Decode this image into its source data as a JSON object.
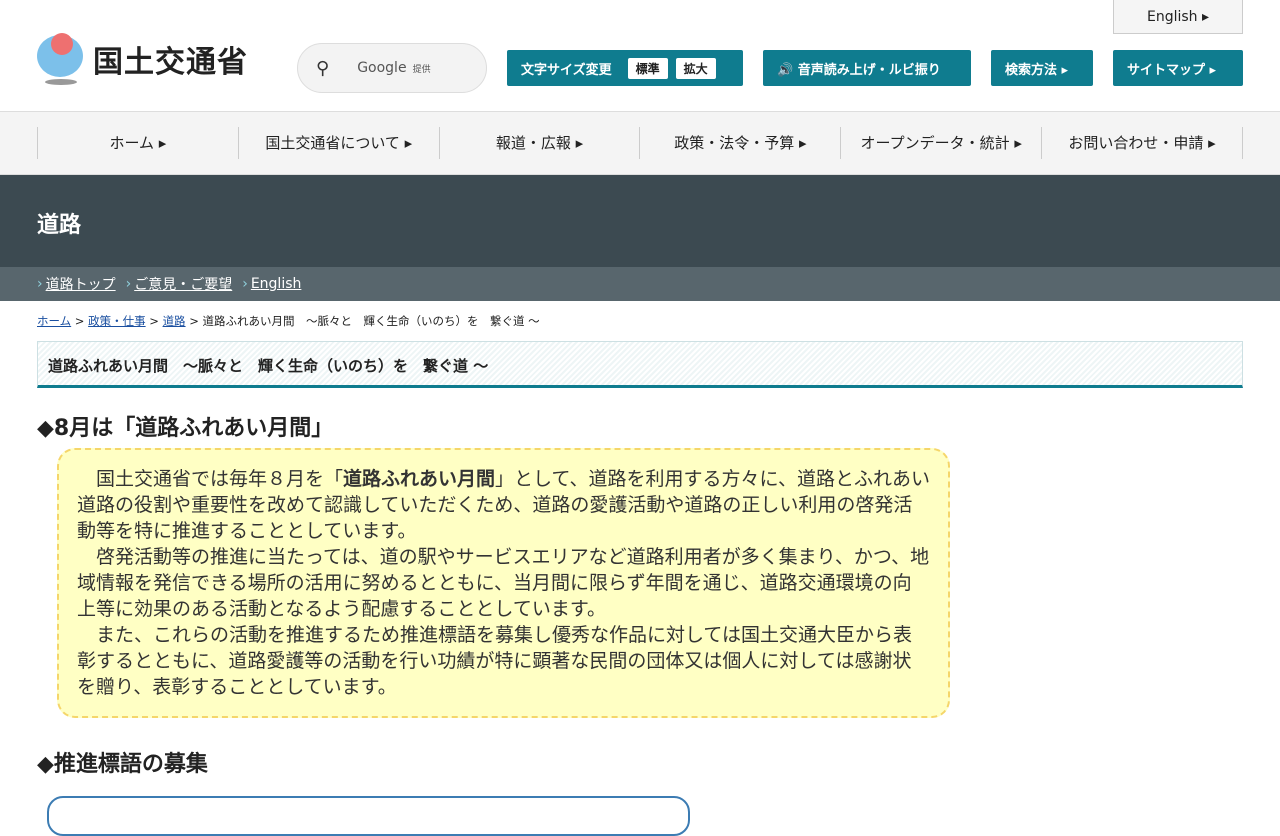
{
  "header": {
    "logo_text": "国土交通省",
    "search_icon": "search-icon",
    "search_brand": "Google",
    "search_provided": "提供",
    "english": "English ▸",
    "font_size_label": "文字サイズ変更",
    "font_standard": "標準",
    "font_large": "拡大",
    "voice_label": "🔊 音声読み上げ・ルビ振り",
    "search_method": "検索方法 ▸",
    "sitemap": "サイトマップ ▸"
  },
  "gnav": [
    "ホーム ▸",
    "国土交通省について ▸",
    "報道・広報 ▸",
    "政策・法令・予算 ▸",
    "オープンデータ・統計 ▸",
    "お問い合わせ・申請 ▸"
  ],
  "band": {
    "title": "道路"
  },
  "subnav": [
    "道路トップ",
    "ご意見・ご要望",
    "English"
  ],
  "breadcrumb": {
    "items": [
      "ホーム",
      "政策・仕事",
      "道路"
    ],
    "current": "道路ふれあい月間　～脈々と　輝く生命（いのち）を　繋ぐ道 ～"
  },
  "page_title": "道路ふれあい月間　～脈々と　輝く生命（いのち）を　繋ぐ道 ～",
  "section1": {
    "heading": "◆8月は「道路ふれあい月間」",
    "p1_pre": "国土交通省では毎年８月を「",
    "p1_bold": "道路ふれあい月間",
    "p1_post": "」として、道路を利用する方々に、道路とふれあい道路の役割や重要性を改めて認識していただくため、道路の愛護活動や道路の正しい利用の啓発活動等を特に推進することとしています。",
    "p2": "啓発活動等の推進に当たっては、道の駅やサービスエリアなど道路利用者が多く集まり、かつ、地域情報を発信できる場所の活用に努めるとともに、当月間に限らず年間を通じ、道路交通環境の向上等に効果のある活動となるよう配慮することとしています。",
    "p3": "また、これらの活動を推進するため推進標語を募集し優秀な作品に対しては国土交通大臣から表彰するとともに、道路愛護等の活動を行い功績が特に顕著な民間の団体又は個人に対しては感謝状を贈り、表彰することとしています。"
  },
  "section2": {
    "heading": "◆推進標語の募集"
  }
}
